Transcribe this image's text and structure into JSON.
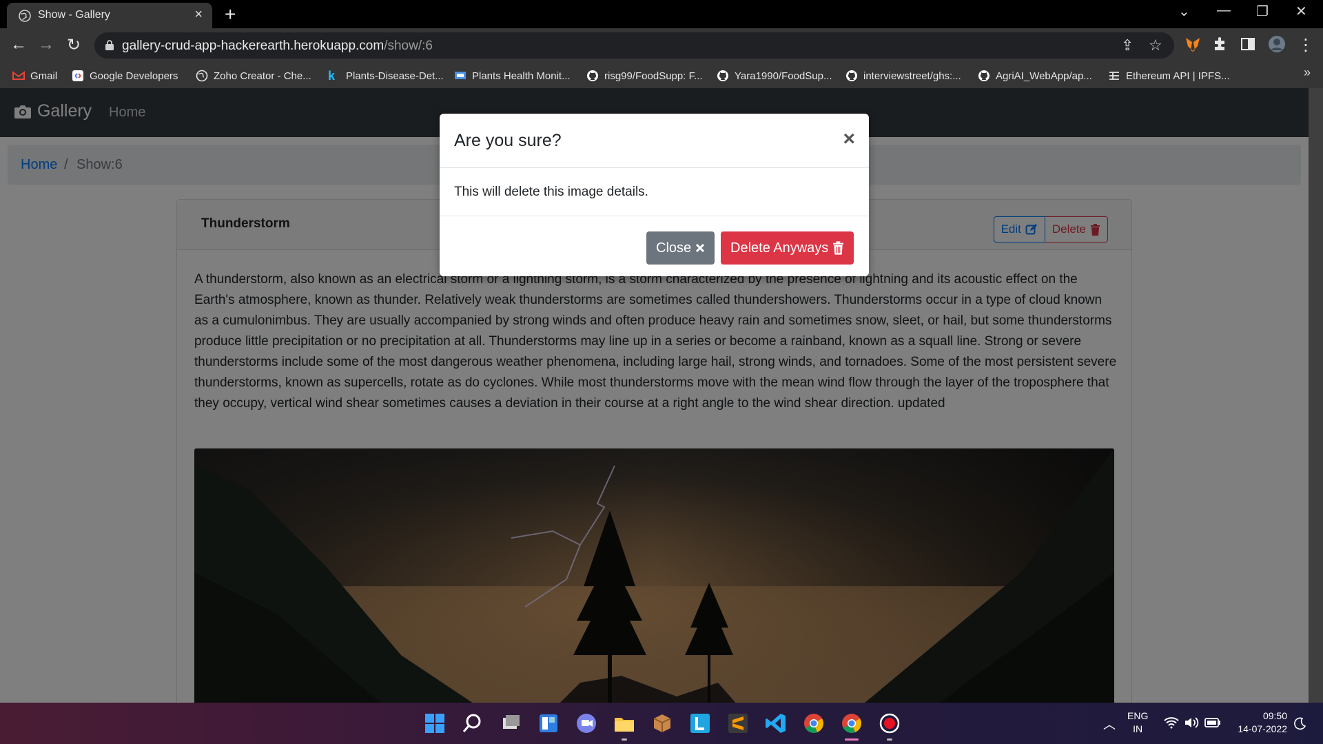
{
  "browser": {
    "tab_title": "Show - Gallery",
    "tab_close": "×",
    "new_tab": "+",
    "url_host": "gallery-crud-app-hackerearth.herokuapp.com",
    "url_path": "/show/:6",
    "window_controls": {
      "dropdown": "⌄",
      "minimize": "—",
      "restore": "❐",
      "close": "✕"
    }
  },
  "bookmarks": [
    {
      "label": "Gmail",
      "icon": "gmail-icon",
      "color": "#ea4335"
    },
    {
      "label": "Google Developers",
      "icon": "google-developers-icon",
      "color": "#4285f4"
    },
    {
      "label": "Zoho Creator - Che...",
      "icon": "globe-icon",
      "color": "#e6e6e6"
    },
    {
      "label": "Plants-Disease-Det...",
      "icon": "kaggle-icon",
      "color": "#20beff"
    },
    {
      "label": "Plants Health Monit...",
      "icon": "slides-icon",
      "color": "#4a90e2"
    },
    {
      "label": "risg99/FoodSupp: F...",
      "icon": "github-icon",
      "color": "#ffffff"
    },
    {
      "label": "Yara1990/FoodSup...",
      "icon": "github-icon",
      "color": "#ffffff"
    },
    {
      "label": "interviewstreet/ghs:...",
      "icon": "github-icon",
      "color": "#ffffff"
    },
    {
      "label": "AgriAI_WebApp/ap...",
      "icon": "github-icon",
      "color": "#ffffff"
    },
    {
      "label": "Ethereum API | IPFS...",
      "icon": "infura-icon",
      "color": "#e6e6e6"
    }
  ],
  "bookmarks_more": "»",
  "app": {
    "brand": "Gallery",
    "nav_home": "Home",
    "breadcrumb": {
      "home": "Home",
      "separator": "/",
      "current": "Show:6"
    }
  },
  "card": {
    "title": "Thunderstorm",
    "edit_label": "Edit",
    "delete_label": "Delete",
    "description": "A thunderstorm, also known as an electrical storm or a lightning storm, is a storm characterized by the presence of lightning and its acoustic effect on the Earth's atmosphere, known as thunder. Relatively weak thunderstorms are sometimes called thundershowers. Thunderstorms occur in a type of cloud known as a cumulonimbus. They are usually accompanied by strong winds and often produce heavy rain and sometimes snow, sleet, or hail, but some thunderstorms produce little precipitation or no precipitation at all. Thunderstorms may line up in a series or become a rainband, known as a squall line. Strong or severe thunderstorms include some of the most dangerous weather phenomena, including large hail, strong winds, and tornadoes. Some of the most persistent severe thunderstorms, known as supercells, rotate as do cyclones. While most thunderstorms move with the mean wind flow through the layer of the troposphere that they occupy, vertical wind shear sometimes causes a deviation in their course at a right angle to the wind shear direction. updated"
  },
  "modal": {
    "title": "Are you sure?",
    "close_x": "×",
    "body": "This will delete this image details.",
    "close_button": "Close",
    "delete_button": "Delete Anyways"
  },
  "taskbar": {
    "language_top": "ENG",
    "language_bottom": "IN",
    "time": "09:50",
    "date": "14-07-2022"
  },
  "colors": {
    "navbar": "#343a40",
    "primary": "#007bff",
    "danger": "#dc3545",
    "secondary": "#6c757d"
  }
}
